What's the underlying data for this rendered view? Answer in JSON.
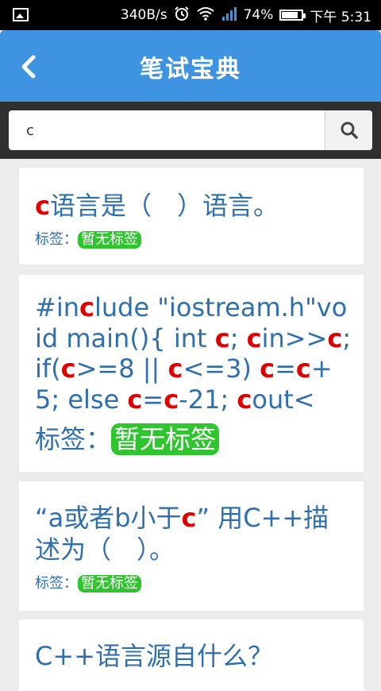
{
  "status_bar": {
    "net_speed": "340B/s",
    "battery": "74%",
    "time": "下午 5:31"
  },
  "header": {
    "title": "笔试宝典"
  },
  "search": {
    "value": "c"
  },
  "results": [
    {
      "question_parts": [
        {
          "text": "c",
          "highlight": true
        },
        {
          "text": "语言是（　）语言。",
          "highlight": false
        }
      ],
      "tag_label": "标签：",
      "tag": "暂无标签"
    },
    {
      "question_parts": [
        {
          "text": "#in",
          "highlight": false
        },
        {
          "text": "c",
          "highlight": true
        },
        {
          "text": "lude \"iostream.h\"void main(){ int ",
          "highlight": false
        },
        {
          "text": "c",
          "highlight": true
        },
        {
          "text": "; ",
          "highlight": false
        },
        {
          "text": "c",
          "highlight": true
        },
        {
          "text": "in>>",
          "highlight": false
        },
        {
          "text": "c",
          "highlight": true
        },
        {
          "text": "; if(",
          "highlight": false
        },
        {
          "text": "c",
          "highlight": true
        },
        {
          "text": ">=8 || ",
          "highlight": false
        },
        {
          "text": "c",
          "highlight": true
        },
        {
          "text": "<=3) ",
          "highlight": false
        },
        {
          "text": "c",
          "highlight": true
        },
        {
          "text": "=",
          "highlight": false
        },
        {
          "text": "c",
          "highlight": true
        },
        {
          "text": "+5; else ",
          "highlight": false
        },
        {
          "text": "c",
          "highlight": true
        },
        {
          "text": "=",
          "highlight": false
        },
        {
          "text": "c",
          "highlight": true
        },
        {
          "text": "-21; ",
          "highlight": false
        },
        {
          "text": "c",
          "highlight": true
        },
        {
          "text": "out<",
          "highlight": false
        }
      ],
      "tag_label": "标签：",
      "tag": "暂无标签"
    },
    {
      "question_parts": [
        {
          "text": "“a或者b小于",
          "highlight": false
        },
        {
          "text": "c",
          "highlight": true
        },
        {
          "text": "” 用C++描述为（　）。",
          "highlight": false
        }
      ],
      "tag_label": "标签：",
      "tag": "暂无标签"
    },
    {
      "question_parts": [
        {
          "text": "C++语言源自什么？",
          "highlight": false
        }
      ],
      "tag_label": "",
      "tag": ""
    }
  ]
}
